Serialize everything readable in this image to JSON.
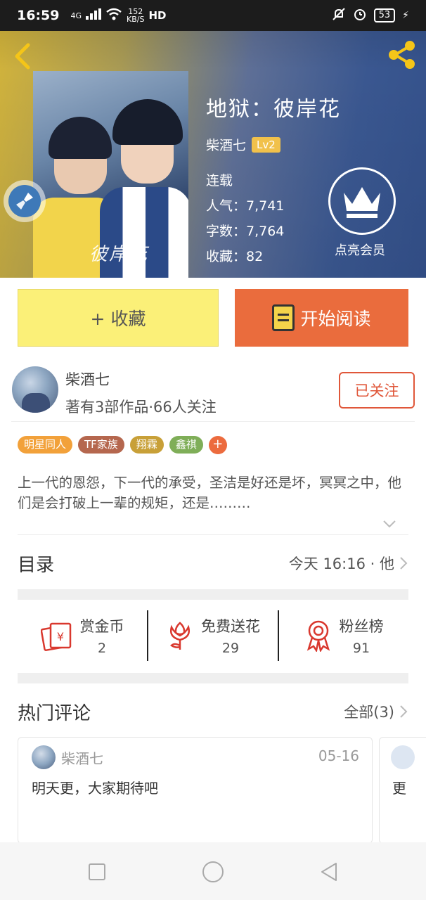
{
  "status": {
    "time": "16:59",
    "net_type": "4G",
    "speed": "152",
    "speed_unit": "KB/S",
    "hd": "HD",
    "battery": "53"
  },
  "book": {
    "title": "地狱：彼岸花",
    "author": "柴酒七",
    "level": "Lv2",
    "status": "连载",
    "popularity": "人气：7,741",
    "word_count": "字数：7,764",
    "favorites": "收藏：82",
    "cover_signature": "彼岸花",
    "vip_label": "点亮会员"
  },
  "actions": {
    "collect": "+ 收藏",
    "read": "开始阅读"
  },
  "author_block": {
    "name": "柴酒七",
    "meta": "著有3部作品·66人关注",
    "follow": "已关注"
  },
  "tags": [
    {
      "label": "明星同人",
      "color": "#f2a13a"
    },
    {
      "label": "TF家族",
      "color": "#b5674e"
    },
    {
      "label": "翔霖",
      "color": "#c8a038"
    },
    {
      "label": "鑫祺",
      "color": "#7fae58"
    },
    {
      "label": "+",
      "color": "#ec6b3e"
    }
  ],
  "description": "上一代的恩怨，下一代的承受，圣洁是好还是坏，冥冥之中，他们是会打破上一辈的规矩，还是………",
  "toc": {
    "heading": "目录",
    "latest": "今天 16:16 · 他"
  },
  "stats": [
    {
      "label": "赏金币",
      "value": "2",
      "icon": "red-envelope-icon"
    },
    {
      "label": "免费送花",
      "value": "29",
      "icon": "flower-icon"
    },
    {
      "label": "粉丝榜",
      "value": "91",
      "icon": "medal-icon"
    }
  ],
  "comments": {
    "heading": "热门评论",
    "all": "全部(3)",
    "items": [
      {
        "user": "柴酒七",
        "date": "05-16",
        "text": "明天更，大家期待吧"
      },
      {
        "user": "",
        "date": "",
        "text": "更"
      }
    ]
  },
  "colors": {
    "accent": "#ea6c3d",
    "collect_bg": "#fbf078",
    "follow": "#e0573a",
    "icon_red": "#d9382e"
  }
}
